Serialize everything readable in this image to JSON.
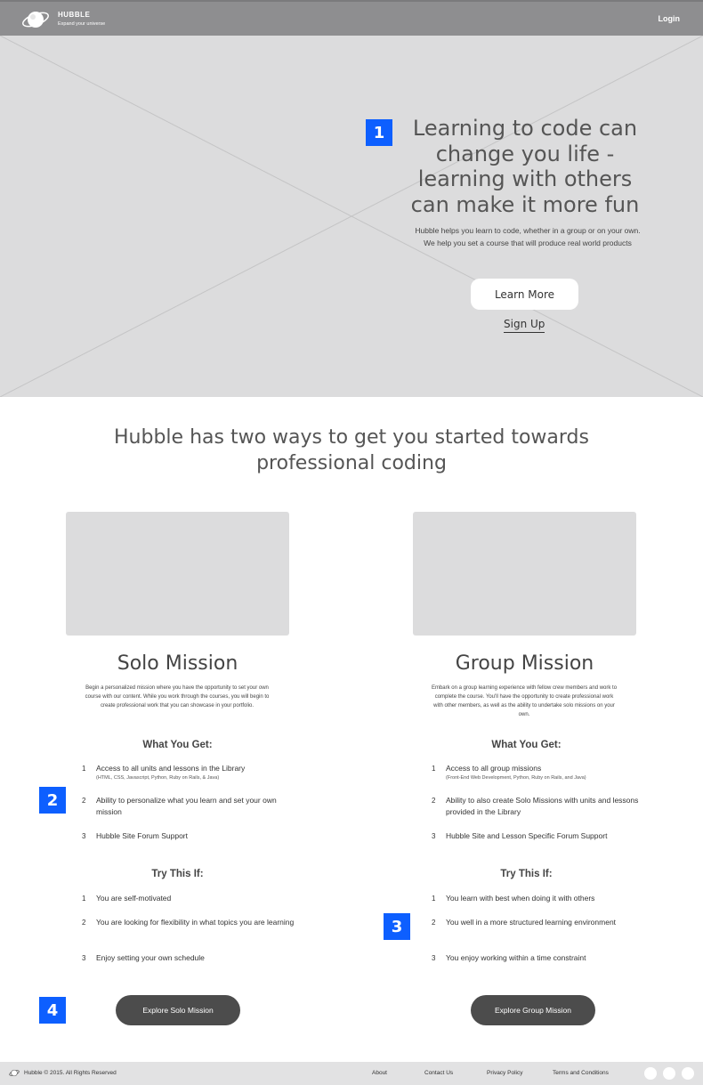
{
  "header": {
    "brand_name": "HUBBLE",
    "brand_tagline": "Expand your universe",
    "login_label": "Login",
    "background_color": "#8e8e90"
  },
  "hero": {
    "badge": "1",
    "title": "Learning to code can change you life - learning with others can make it more fun",
    "description": "Hubble helps you learn to code, whether in a group or on your own. We help you set a course that will produce real world products",
    "learn_more_label": "Learn More",
    "sign_up_label": "Sign Up",
    "placeholder_color": "#dcdcdd"
  },
  "section": {
    "title": "Hubble has two ways to get you started towards professional coding"
  },
  "solo": {
    "title": "Solo Mission",
    "description": "Begin a personalized mission where you have the opportunity to set your own course with our content. While you work through the courses, you will begin to create professional work that you can showcase in your portfolio.",
    "what_you_get_title": "What You Get:",
    "what_you_get": [
      {
        "num": "1",
        "text": "Access to all units and lessons in the Library",
        "note": "(HTML, CSS, Javascript, Python, Ruby on Rails, & Java)"
      },
      {
        "num": "2",
        "text": "Ability to personalize what you learn and set your own mission",
        "note": ""
      },
      {
        "num": "3",
        "text": "Hubble Site Forum Support",
        "note": ""
      }
    ],
    "try_this_title": "Try This If:",
    "try_this": [
      {
        "num": "1",
        "text": "You are self-motivated"
      },
      {
        "num": "2",
        "text": "You are looking for flexibility in what topics you are learning"
      },
      {
        "num": "3",
        "text": "Enjoy setting your own schedule"
      }
    ],
    "cta_label": "Explore Solo Mission"
  },
  "group": {
    "title": "Group Mission",
    "description": "Embark on a group learning experience with fellow crew members and work to complete the course. You'll have the opportunity to create professional work with other members, as well as the ability to undertake solo missions on your own.",
    "what_you_get_title": "What You Get:",
    "what_you_get": [
      {
        "num": "1",
        "text": "Access to all group missions",
        "note": "(Front-End Web Development, Python, Ruby on Rails, and Java)"
      },
      {
        "num": "2",
        "text": "Ability to also create Solo Missions with units and lessons provided in the Library",
        "note": ""
      },
      {
        "num": "3",
        "text": "Hubble Site and Lesson Specific Forum Support",
        "note": ""
      }
    ],
    "try_this_title": "Try This If:",
    "try_this": [
      {
        "num": "1",
        "text": "You learn with best when doing it with others"
      },
      {
        "num": "2",
        "text": "You well in a more structured learning environment"
      },
      {
        "num": "3",
        "text": "You enjoy working within a time constraint"
      }
    ],
    "cta_label": "Explore Group Mission"
  },
  "annotations": {
    "badge_2": "2",
    "badge_3": "3",
    "badge_4": "4",
    "badge_color": "#0d5fff"
  },
  "footer": {
    "copyright": "Hubble © 2015. All Rights Reserved",
    "links": [
      "About",
      "Contact Us",
      "Privacy Policy",
      "Terms and Conditions"
    ],
    "social_icons": [
      "social-circle-icon",
      "social-circle-icon",
      "social-circle-icon"
    ]
  }
}
